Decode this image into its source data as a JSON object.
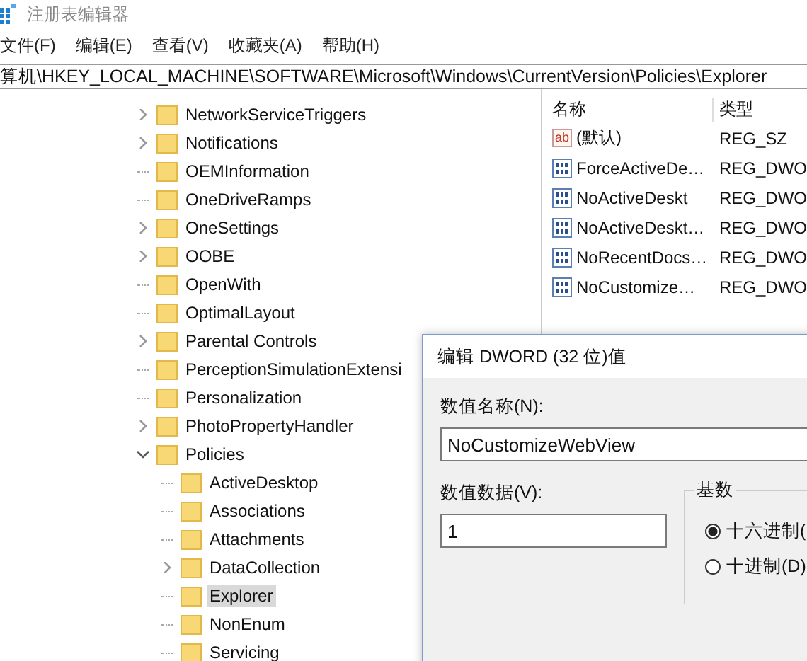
{
  "window": {
    "title": "注册表编辑器"
  },
  "menu": [
    "文件(F)",
    "编辑(E)",
    "查看(V)",
    "收藏夹(A)",
    "帮助(H)"
  ],
  "address": "算机\\HKEY_LOCAL_MACHINE\\SOFTWARE\\Microsoft\\Windows\\CurrentVersion\\Policies\\Explorer",
  "tree": [
    {
      "label": "NetworkServiceTriggers",
      "kind": "collapsed",
      "selected": false
    },
    {
      "label": "Notifications",
      "kind": "collapsed",
      "selected": false
    },
    {
      "label": "OEMInformation",
      "kind": "leaf",
      "selected": false
    },
    {
      "label": "OneDriveRamps",
      "kind": "leaf",
      "selected": false
    },
    {
      "label": "OneSettings",
      "kind": "collapsed",
      "selected": false
    },
    {
      "label": "OOBE",
      "kind": "collapsed",
      "selected": false
    },
    {
      "label": "OpenWith",
      "kind": "leaf",
      "selected": false
    },
    {
      "label": "OptimalLayout",
      "kind": "leaf",
      "selected": false
    },
    {
      "label": "Parental Controls",
      "kind": "collapsed",
      "selected": false
    },
    {
      "label": "PerceptionSimulationExtensi",
      "kind": "leaf",
      "selected": false
    },
    {
      "label": "Personalization",
      "kind": "leaf",
      "selected": false
    },
    {
      "label": "PhotoPropertyHandler",
      "kind": "collapsed",
      "selected": false
    },
    {
      "label": "Policies",
      "kind": "expanded",
      "selected": false,
      "children": [
        {
          "label": "ActiveDesktop",
          "kind": "leaf",
          "selected": false
        },
        {
          "label": "Associations",
          "kind": "leaf",
          "selected": false
        },
        {
          "label": "Attachments",
          "kind": "leaf",
          "selected": false
        },
        {
          "label": "DataCollection",
          "kind": "collapsed",
          "selected": false
        },
        {
          "label": "Explorer",
          "kind": "leaf",
          "selected": true
        },
        {
          "label": "NonEnum",
          "kind": "leaf",
          "selected": false
        },
        {
          "label": "Servicing",
          "kind": "leaf",
          "selected": false
        }
      ]
    }
  ],
  "values": {
    "columns": [
      "名称",
      "类型"
    ],
    "rows": [
      {
        "kind": "string",
        "icon_label": "ab",
        "name": "(默认)",
        "type": "REG_SZ"
      },
      {
        "kind": "dword",
        "name": "ForceActiveDe…",
        "type": "REG_DWO"
      },
      {
        "kind": "dword",
        "name": "NoActiveDeskt",
        "type": "REG_DWO"
      },
      {
        "kind": "dword",
        "name": "NoActiveDeskt…",
        "type": "REG_DWO"
      },
      {
        "kind": "dword",
        "name": "NoRecentDocs…",
        "type": "REG_DWO"
      },
      {
        "kind": "dword",
        "name": "NoCustomize…",
        "type": "REG_DWO"
      }
    ]
  },
  "dialog": {
    "title": "编辑 DWORD (32 位)值",
    "name_label": "数值名称(N):",
    "name_value": "NoCustomizeWebView",
    "data_label": "数值数据(V):",
    "data_value": "1",
    "base_label": "基数",
    "radios": [
      {
        "label": "十六进制(",
        "selected": true
      },
      {
        "label": "十进制(D)",
        "selected": false
      }
    ]
  }
}
